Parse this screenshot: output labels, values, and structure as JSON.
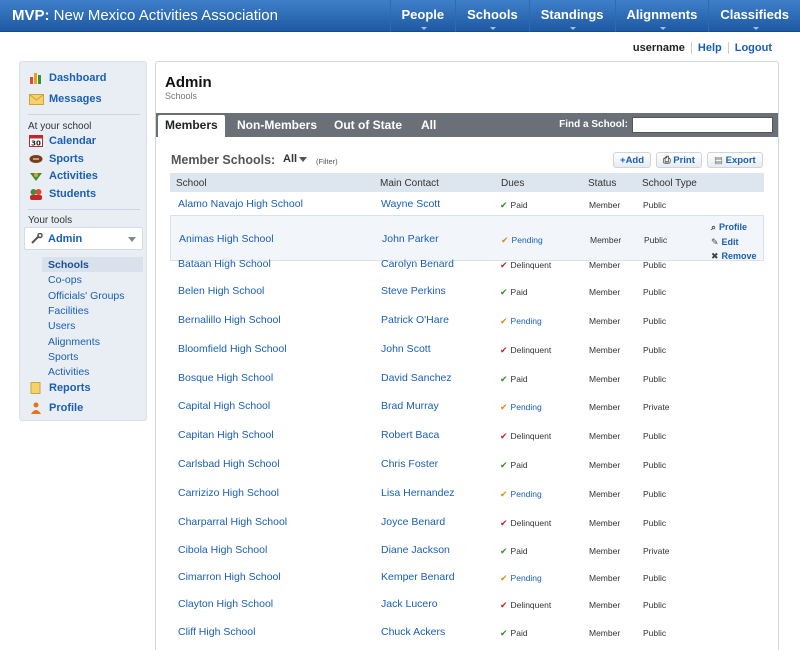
{
  "app": {
    "brand_bold": "MVP:",
    "brand_rest": " New Mexico Activities Association"
  },
  "nav": [
    "People",
    "Schools",
    "Standings",
    "Alignments",
    "Classifieds"
  ],
  "userbar": {
    "username": "username",
    "help": "Help",
    "logout": "Logout"
  },
  "sidebar": {
    "dashboard": "Dashboard",
    "messages": "Messages",
    "at_school_heading": "At your school",
    "calendar": "Calendar",
    "calendar_day": "30",
    "sports": "Sports",
    "activities": "Activities",
    "students": "Students",
    "tools_heading": "Your tools",
    "admin": "Admin",
    "admin_items": [
      "Schools",
      "Co-ops",
      "Officials' Groups",
      "Facilities",
      "Users",
      "Alignments",
      "Sports",
      "Activities"
    ],
    "reports": "Reports",
    "profile": "Profile"
  },
  "main": {
    "title": "Admin",
    "subtitle": "Schools",
    "tabs": [
      "Members",
      "Non-Members",
      "Out of State",
      "All"
    ],
    "find_label": "Find a School:",
    "find_value": "",
    "list_title": "Member Schools:",
    "list_filter_value": "All",
    "filter_note": "(Filter)",
    "buttons": {
      "add": "Add",
      "print": "Print",
      "export": "Export"
    },
    "columns": [
      "School",
      "Main Contact",
      "Dues",
      "Status",
      "School Type"
    ],
    "row_actions": {
      "profile": "Profile",
      "edit": "Edit",
      "remove": "Remove"
    },
    "rows": [
      {
        "school": "Alamo Navajo High School",
        "contact": "Wayne Scott",
        "dues": "Paid",
        "status": "Member",
        "type": "Public"
      },
      {
        "school": "Animas High School",
        "contact": "John Parker",
        "dues": "Pending",
        "status": "Member",
        "type": "Public"
      },
      {
        "school": "Bataan High School",
        "contact": "Carolyn Benard",
        "dues": "Delinquent",
        "status": "Member",
        "type": "Public"
      },
      {
        "school": "Belen High School",
        "contact": "Steve Perkins",
        "dues": "Paid",
        "status": "Member",
        "type": "Public"
      },
      {
        "school": "Bernalillo High School",
        "contact": "Patrick O'Hare",
        "dues": "Pending",
        "status": "Member",
        "type": "Public"
      },
      {
        "school": "Bloomfield High School",
        "contact": "John Scott",
        "dues": "Delinquent",
        "status": "Member",
        "type": "Public"
      },
      {
        "school": "Bosque High School",
        "contact": "David Sanchez",
        "dues": "Paid",
        "status": "Member",
        "type": "Public"
      },
      {
        "school": "Capital High School",
        "contact": "Brad Murray",
        "dues": "Pending",
        "status": "Member",
        "type": "Private"
      },
      {
        "school": "Capitan High School",
        "contact": "Robert Baca",
        "dues": "Delinquent",
        "status": "Member",
        "type": "Public"
      },
      {
        "school": "Carlsbad High School",
        "contact": "Chris Foster",
        "dues": "Paid",
        "status": "Member",
        "type": "Public"
      },
      {
        "school": "Carrizizo High School",
        "contact": "Lisa Hernandez",
        "dues": "Pending",
        "status": "Member",
        "type": "Public"
      },
      {
        "school": "Charparral High School",
        "contact": "Joyce Benard",
        "dues": "Delinquent",
        "status": "Member",
        "type": "Public"
      },
      {
        "school": "Cibola High School",
        "contact": "Diane Jackson",
        "dues": "Paid",
        "status": "Member",
        "type": "Private"
      },
      {
        "school": "Cimarron High School",
        "contact": "Kemper Benard",
        "dues": "Pending",
        "status": "Member",
        "type": "Public"
      },
      {
        "school": "Clayton High School",
        "contact": "Jack Lucero",
        "dues": "Delinquent",
        "status": "Member",
        "type": "Public"
      },
      {
        "school": "Cliff High School",
        "contact": "Chuck Ackers",
        "dues": "Paid",
        "status": "Member",
        "type": "Public"
      }
    ],
    "highlighted_row": 1,
    "dues_colors": {
      "Paid": "#3a8a2e",
      "Pending": "#e08a1a",
      "Delinquent": "#c0282b"
    }
  }
}
